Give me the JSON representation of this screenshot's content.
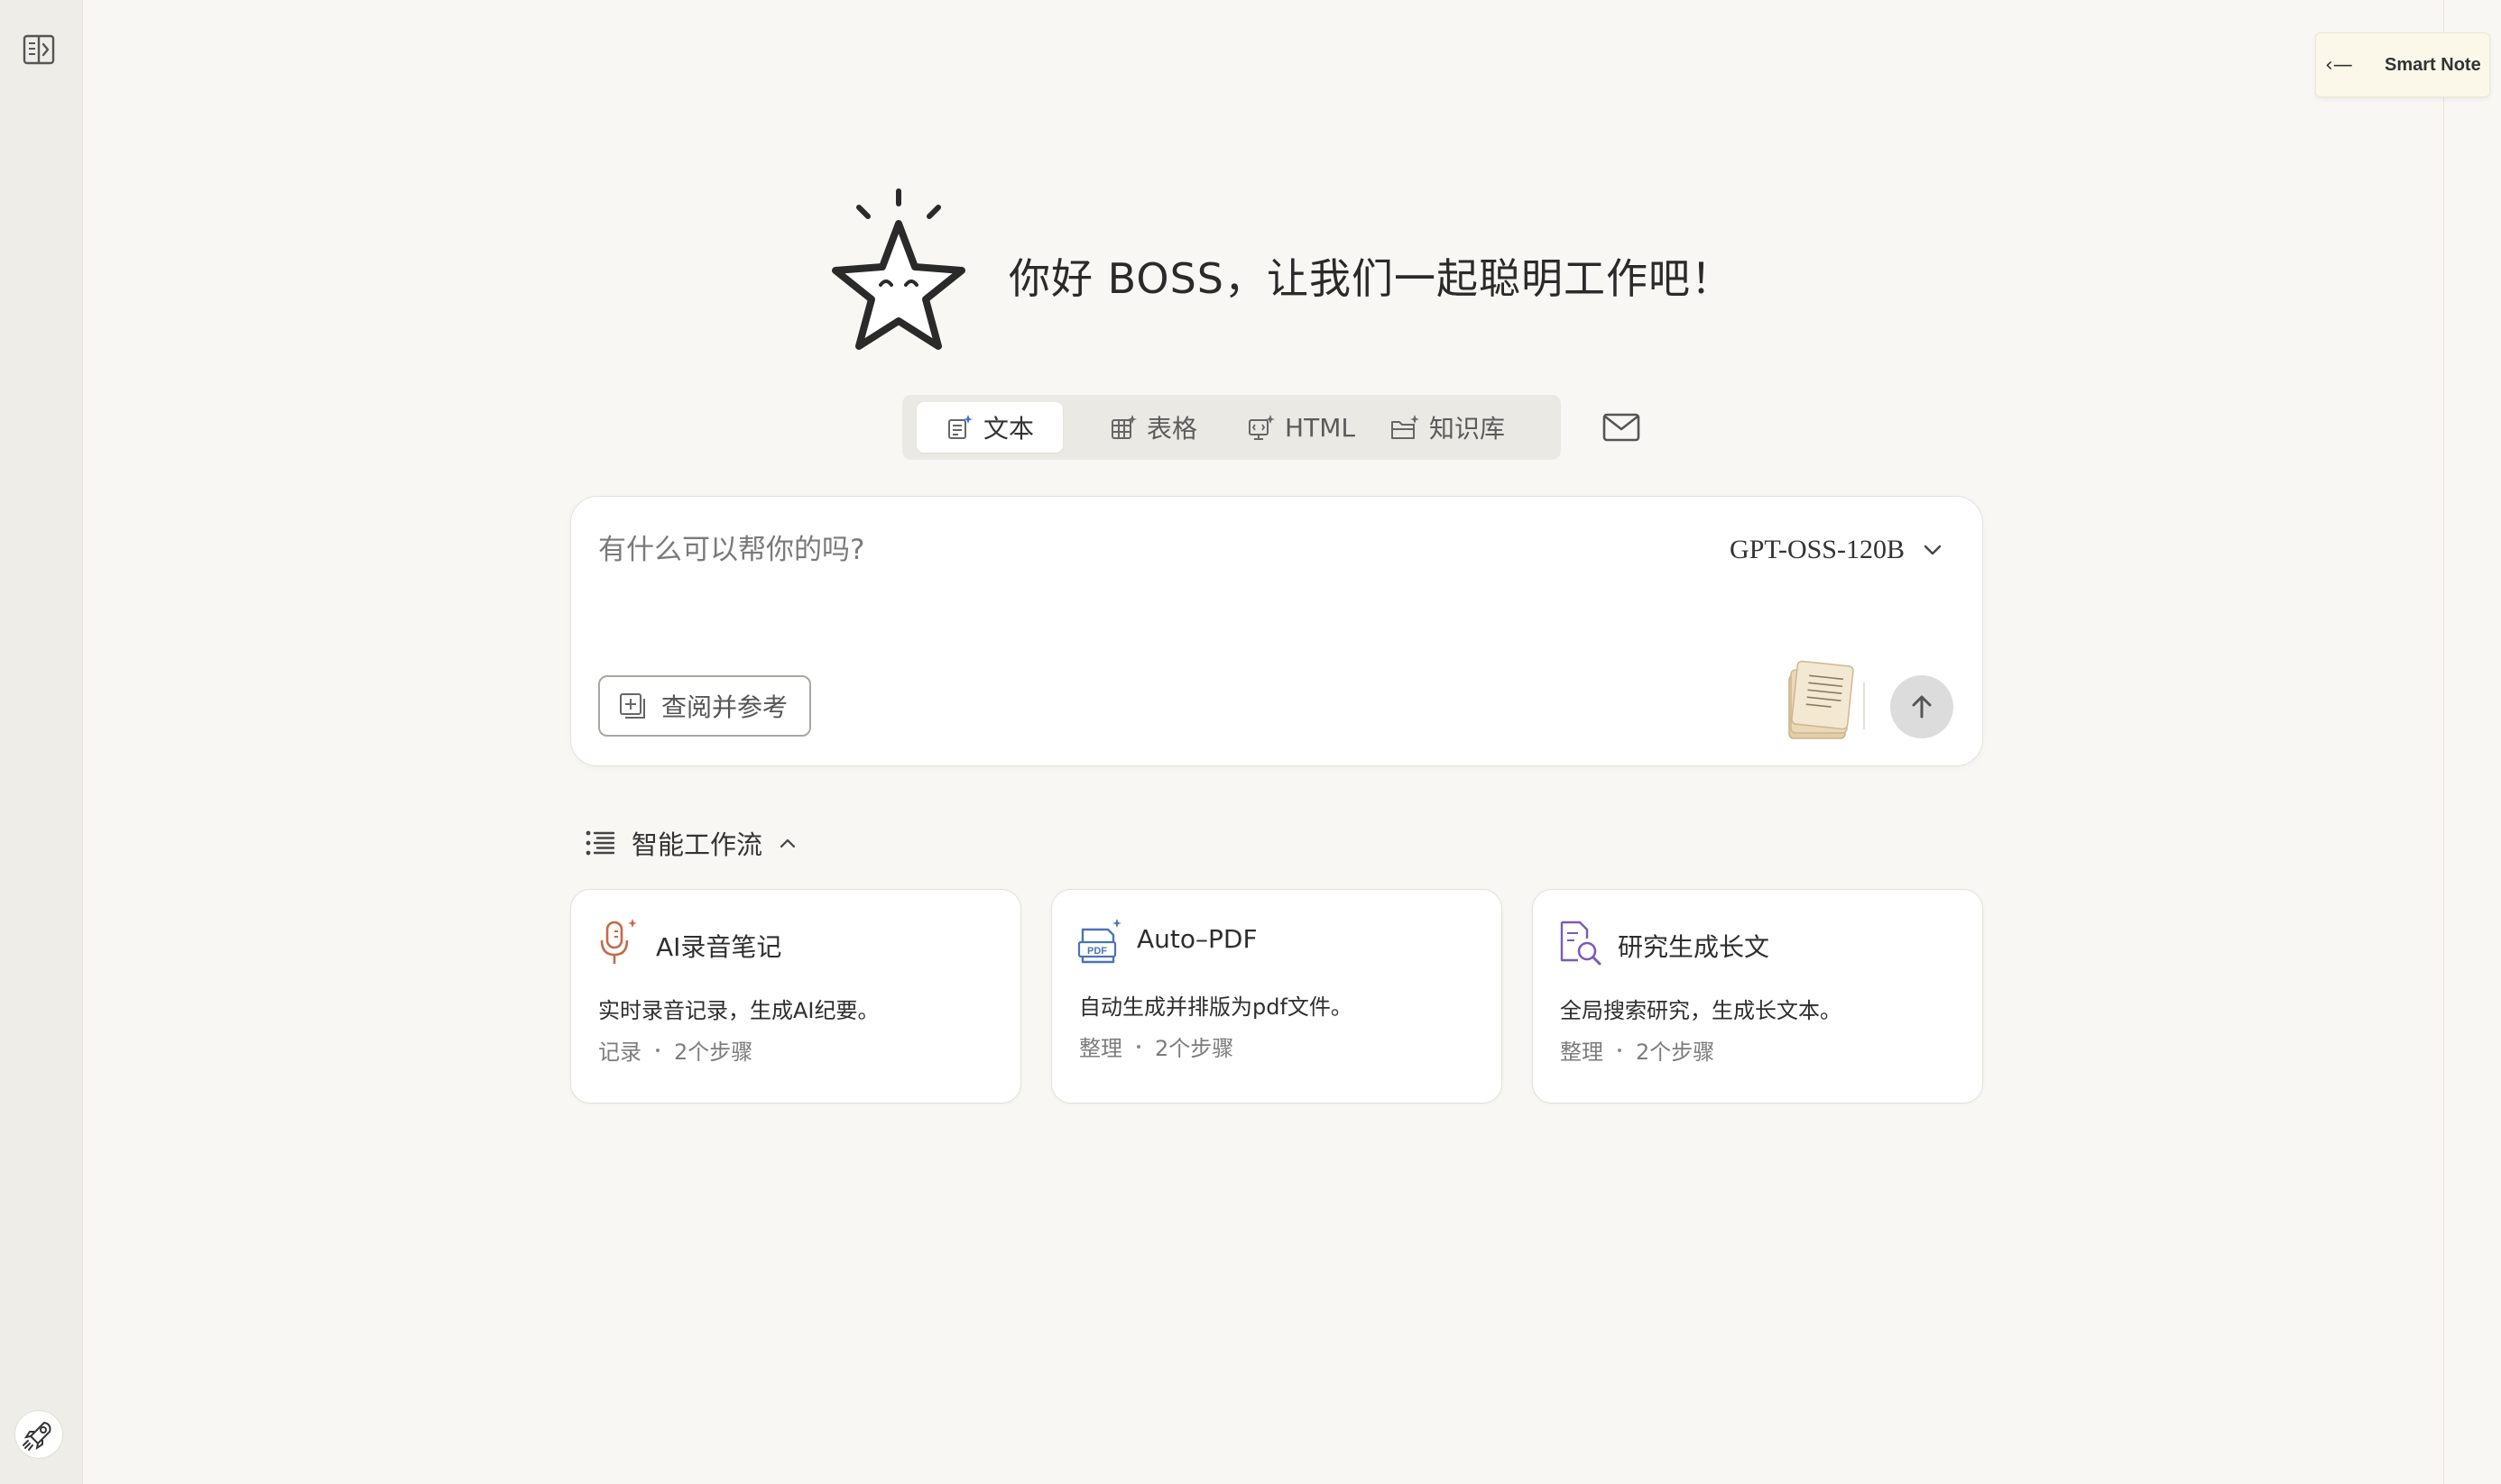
{
  "hero": {
    "greeting": "你好 BOSS，让我们一起聪明工作吧！",
    "mascot": "star-mascot-icon"
  },
  "smart_note": {
    "arrow": "‹—",
    "label": "Smart Note"
  },
  "tabs": [
    {
      "label": "文本",
      "icon": "text-sparkle-icon",
      "active": true
    },
    {
      "label": "表格",
      "icon": "table-sparkle-icon",
      "active": false
    },
    {
      "label": "HTML",
      "icon": "html-sparkle-icon",
      "active": false
    },
    {
      "label": "知识库",
      "icon": "folder-sparkle-icon",
      "active": false
    }
  ],
  "composer": {
    "placeholder": "有什么可以帮你的吗?",
    "model": "GPT-OSS-120B",
    "reference_label": "查阅并参考"
  },
  "workflow": {
    "title": "智能工作流",
    "cards": [
      {
        "title": "AI录音笔记",
        "description": "实时录音记录，生成AI纪要。",
        "category": "记录",
        "steps": "2个步骤",
        "icon": "microphone-icon",
        "accent": "#c8684a"
      },
      {
        "title": "Auto–PDF",
        "description": "自动生成并排版为pdf文件。",
        "category": "整理",
        "steps": "2个步骤",
        "icon": "pdf-icon",
        "accent": "#4a74b8"
      },
      {
        "title": "研究生成长文",
        "description": "全局搜索研究，生成长文本。",
        "category": "整理",
        "steps": "2个步骤",
        "icon": "document-search-icon",
        "accent": "#7a5bb5"
      }
    ]
  },
  "colors": {
    "background": "#f8f7f4",
    "rail": "#efede8",
    "note": "#fbf8ea"
  }
}
